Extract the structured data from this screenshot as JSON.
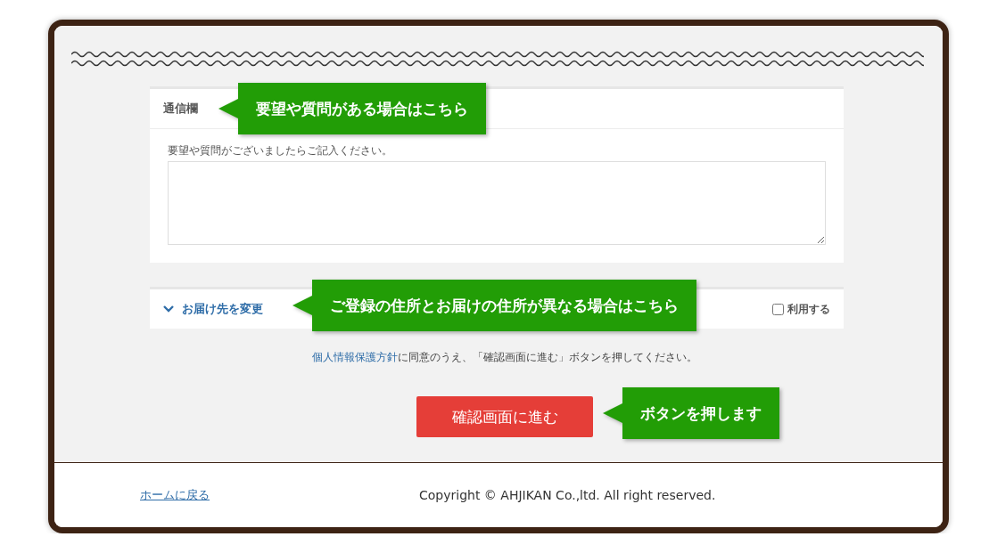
{
  "message_panel": {
    "title": "通信欄",
    "prompt": "要望や質問がございましたらご記入ください。",
    "callout": "要望や質問がある場合はこちら"
  },
  "delivery_panel": {
    "title": "お届け先を変更",
    "expanded": false,
    "use_label": "利用する",
    "use_checked": false,
    "callout": "ご登録の住所とお届けの住所が異なる場合はこちら"
  },
  "consent": {
    "link": "個人情報保護方針",
    "text": "に同意のうえ、「確認画面に進む」ボタンを押してください。"
  },
  "submit": {
    "label": "確認画面に進む",
    "callout": "ボタンを押します"
  },
  "footer": {
    "home_link": "ホームに戻る",
    "copyright": "Copyright © AHJIKAN Co.,ltd. All right reserved."
  }
}
